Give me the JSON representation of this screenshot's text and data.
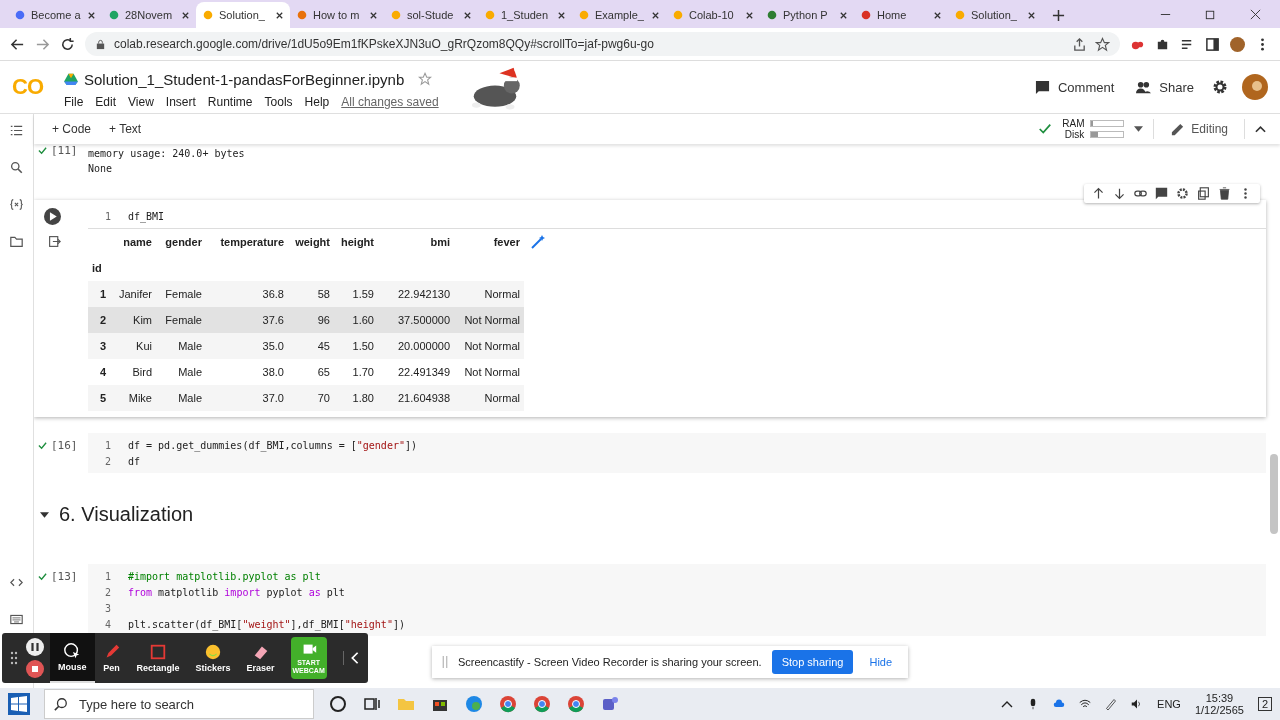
{
  "browser": {
    "tabs": [
      {
        "label": "Become a",
        "selected": false
      },
      {
        "label": "28Novem",
        "selected": false
      },
      {
        "label": "Solution_",
        "selected": true
      },
      {
        "label": "How to m",
        "selected": false
      },
      {
        "label": "sol-Stude",
        "selected": false
      },
      {
        "label": "1_Studen",
        "selected": false
      },
      {
        "label": "Example_",
        "selected": false
      },
      {
        "label": "Colab-10",
        "selected": false
      },
      {
        "label": "Python P",
        "selected": false
      },
      {
        "label": "Home",
        "selected": false
      },
      {
        "label": "Solution_",
        "selected": false
      }
    ],
    "address": "colab.research.google.com/drive/1dU5o9Em1fKPskeXJN3uO_gRrQzom8QQy#scrollTo=jaf-pwg6u-go"
  },
  "colab": {
    "logo": "CO",
    "title": "Solution_1_Student-1-pandasForBeginner.ipynb",
    "menu": [
      "File",
      "Edit",
      "View",
      "Insert",
      "Runtime",
      "Tools",
      "Help"
    ],
    "save_status": "All changes saved",
    "comment": "Comment",
    "share": "Share",
    "add_code": "+ Code",
    "add_text": "+ Text",
    "resources": [
      {
        "label": "RAM",
        "level": 0.05
      },
      {
        "label": "Disk",
        "level": 0.2
      }
    ],
    "mode": "Editing"
  },
  "cells": [
    {
      "kind": "output",
      "count": "[11]",
      "lines": [
        "memory usage: 240.0+ bytes",
        "None"
      ]
    },
    {
      "kind": "table",
      "line_numbers": [
        "1"
      ],
      "code": "df_BMI",
      "index_name": "id",
      "columns": [
        "name",
        "gender",
        "temperature",
        "weight",
        "height",
        "bmi",
        "fever"
      ],
      "rows": [
        {
          "id": "1",
          "cells": [
            "Janifer",
            "Female",
            "36.8",
            "58",
            "1.59",
            "22.942130",
            "Normal"
          ],
          "highlighted": false
        },
        {
          "id": "2",
          "cells": [
            "Kim",
            "Female",
            "37.6",
            "96",
            "1.60",
            "37.500000",
            "Not Normal"
          ],
          "highlighted": true
        },
        {
          "id": "3",
          "cells": [
            "Kui",
            "Male",
            "35.0",
            "45",
            "1.50",
            "20.000000",
            "Not Normal"
          ],
          "highlighted": false
        },
        {
          "id": "4",
          "cells": [
            "Bird",
            "Male",
            "38.0",
            "65",
            "1.70",
            "22.491349",
            "Not Normal"
          ],
          "highlighted": false
        },
        {
          "id": "5",
          "cells": [
            "Mike",
            "Male",
            "37.0",
            "70",
            "1.80",
            "21.604938",
            "Normal"
          ],
          "highlighted": false
        }
      ]
    },
    {
      "kind": "code",
      "count": "[16]",
      "lines": [
        {
          "number": "1",
          "tokens": [
            {
              "text": "df = pd.get_dummies(df_BMI,columns = [",
              "kind": "plain"
            },
            {
              "text": "\"gender\"",
              "kind": "string"
            },
            {
              "text": "])",
              "kind": "plain"
            }
          ]
        },
        {
          "number": "2",
          "tokens": [
            {
              "text": "df",
              "kind": "plain"
            }
          ]
        }
      ]
    },
    {
      "kind": "heading",
      "text": "6. Visualization"
    },
    {
      "kind": "code",
      "count": "[13]",
      "lines": [
        {
          "number": "1",
          "tokens": [
            {
              "text": "#import matplotlib.pyplot as plt",
              "kind": "comment"
            }
          ]
        },
        {
          "number": "2",
          "tokens": [
            {
              "text": "from",
              "kind": "keyword"
            },
            {
              "text": " matplotlib ",
              "kind": "plain"
            },
            {
              "text": "import",
              "kind": "keyword"
            },
            {
              "text": " pyplot ",
              "kind": "plain"
            },
            {
              "text": "as",
              "kind": "keyword"
            },
            {
              "text": " plt",
              "kind": "plain"
            }
          ]
        },
        {
          "number": "3"
        },
        {
          "number": "4",
          "tokens": [
            {
              "text": "plt.scatter(df_BMI[",
              "kind": "plain"
            },
            {
              "text": "\"weight\"",
              "kind": "string"
            },
            {
              "text": "],df_BMI[",
              "kind": "plain"
            },
            {
              "text": "\"height\"",
              "kind": "string"
            },
            {
              "text": "])",
              "kind": "plain"
            }
          ]
        }
      ]
    }
  ],
  "recorder": {
    "tools": [
      {
        "label": "Mouse",
        "selected": true
      },
      {
        "label": "Pen",
        "selected": false
      },
      {
        "label": "Rectangle",
        "selected": false
      },
      {
        "label": "Stickers",
        "selected": false
      },
      {
        "label": "Eraser",
        "selected": false
      }
    ],
    "webcam": "START WEBCAM",
    "notice": "Screencastify - Screen Video Recorder is sharing your screen.",
    "stop": "Stop sharing",
    "hide": "Hide"
  },
  "taskbar": {
    "search_placeholder": "Type here to search",
    "language": "ENG",
    "time": "15:39",
    "date": "1/12/2565",
    "notifications": "2"
  }
}
